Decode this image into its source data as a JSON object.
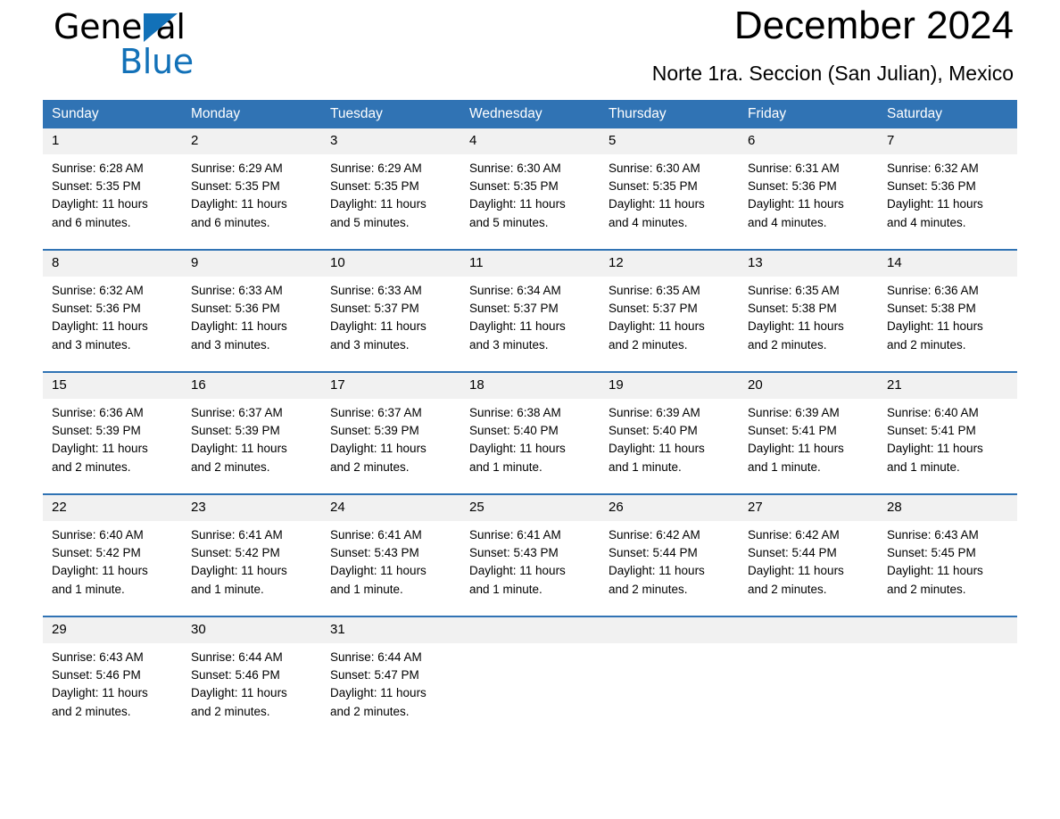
{
  "brand": {
    "name_part1": "General",
    "name_part2": "Blue",
    "triangle_color": "#1271b8"
  },
  "header": {
    "title": "December 2024",
    "subtitle": "Norte 1ra. Seccion (San Julian), Mexico"
  },
  "theme": {
    "header_blue": "#3073b4",
    "daynum_band": "#f1f1f1",
    "text": "#000000",
    "brand_blue": "#1271b8"
  },
  "weekday_headers": [
    "Sunday",
    "Monday",
    "Tuesday",
    "Wednesday",
    "Thursday",
    "Friday",
    "Saturday"
  ],
  "weeks": [
    [
      {
        "day": "1",
        "sunrise": "Sunrise: 6:28 AM",
        "sunset": "Sunset: 5:35 PM",
        "daylight_line1": "Daylight: 11 hours",
        "daylight_line2": "and 6 minutes."
      },
      {
        "day": "2",
        "sunrise": "Sunrise: 6:29 AM",
        "sunset": "Sunset: 5:35 PM",
        "daylight_line1": "Daylight: 11 hours",
        "daylight_line2": "and 6 minutes."
      },
      {
        "day": "3",
        "sunrise": "Sunrise: 6:29 AM",
        "sunset": "Sunset: 5:35 PM",
        "daylight_line1": "Daylight: 11 hours",
        "daylight_line2": "and 5 minutes."
      },
      {
        "day": "4",
        "sunrise": "Sunrise: 6:30 AM",
        "sunset": "Sunset: 5:35 PM",
        "daylight_line1": "Daylight: 11 hours",
        "daylight_line2": "and 5 minutes."
      },
      {
        "day": "5",
        "sunrise": "Sunrise: 6:30 AM",
        "sunset": "Sunset: 5:35 PM",
        "daylight_line1": "Daylight: 11 hours",
        "daylight_line2": "and 4 minutes."
      },
      {
        "day": "6",
        "sunrise": "Sunrise: 6:31 AM",
        "sunset": "Sunset: 5:36 PM",
        "daylight_line1": "Daylight: 11 hours",
        "daylight_line2": "and 4 minutes."
      },
      {
        "day": "7",
        "sunrise": "Sunrise: 6:32 AM",
        "sunset": "Sunset: 5:36 PM",
        "daylight_line1": "Daylight: 11 hours",
        "daylight_line2": "and 4 minutes."
      }
    ],
    [
      {
        "day": "8",
        "sunrise": "Sunrise: 6:32 AM",
        "sunset": "Sunset: 5:36 PM",
        "daylight_line1": "Daylight: 11 hours",
        "daylight_line2": "and 3 minutes."
      },
      {
        "day": "9",
        "sunrise": "Sunrise: 6:33 AM",
        "sunset": "Sunset: 5:36 PM",
        "daylight_line1": "Daylight: 11 hours",
        "daylight_line2": "and 3 minutes."
      },
      {
        "day": "10",
        "sunrise": "Sunrise: 6:33 AM",
        "sunset": "Sunset: 5:37 PM",
        "daylight_line1": "Daylight: 11 hours",
        "daylight_line2": "and 3 minutes."
      },
      {
        "day": "11",
        "sunrise": "Sunrise: 6:34 AM",
        "sunset": "Sunset: 5:37 PM",
        "daylight_line1": "Daylight: 11 hours",
        "daylight_line2": "and 3 minutes."
      },
      {
        "day": "12",
        "sunrise": "Sunrise: 6:35 AM",
        "sunset": "Sunset: 5:37 PM",
        "daylight_line1": "Daylight: 11 hours",
        "daylight_line2": "and 2 minutes."
      },
      {
        "day": "13",
        "sunrise": "Sunrise: 6:35 AM",
        "sunset": "Sunset: 5:38 PM",
        "daylight_line1": "Daylight: 11 hours",
        "daylight_line2": "and 2 minutes."
      },
      {
        "day": "14",
        "sunrise": "Sunrise: 6:36 AM",
        "sunset": "Sunset: 5:38 PM",
        "daylight_line1": "Daylight: 11 hours",
        "daylight_line2": "and 2 minutes."
      }
    ],
    [
      {
        "day": "15",
        "sunrise": "Sunrise: 6:36 AM",
        "sunset": "Sunset: 5:39 PM",
        "daylight_line1": "Daylight: 11 hours",
        "daylight_line2": "and 2 minutes."
      },
      {
        "day": "16",
        "sunrise": "Sunrise: 6:37 AM",
        "sunset": "Sunset: 5:39 PM",
        "daylight_line1": "Daylight: 11 hours",
        "daylight_line2": "and 2 minutes."
      },
      {
        "day": "17",
        "sunrise": "Sunrise: 6:37 AM",
        "sunset": "Sunset: 5:39 PM",
        "daylight_line1": "Daylight: 11 hours",
        "daylight_line2": "and 2 minutes."
      },
      {
        "day": "18",
        "sunrise": "Sunrise: 6:38 AM",
        "sunset": "Sunset: 5:40 PM",
        "daylight_line1": "Daylight: 11 hours",
        "daylight_line2": "and 1 minute."
      },
      {
        "day": "19",
        "sunrise": "Sunrise: 6:39 AM",
        "sunset": "Sunset: 5:40 PM",
        "daylight_line1": "Daylight: 11 hours",
        "daylight_line2": "and 1 minute."
      },
      {
        "day": "20",
        "sunrise": "Sunrise: 6:39 AM",
        "sunset": "Sunset: 5:41 PM",
        "daylight_line1": "Daylight: 11 hours",
        "daylight_line2": "and 1 minute."
      },
      {
        "day": "21",
        "sunrise": "Sunrise: 6:40 AM",
        "sunset": "Sunset: 5:41 PM",
        "daylight_line1": "Daylight: 11 hours",
        "daylight_line2": "and 1 minute."
      }
    ],
    [
      {
        "day": "22",
        "sunrise": "Sunrise: 6:40 AM",
        "sunset": "Sunset: 5:42 PM",
        "daylight_line1": "Daylight: 11 hours",
        "daylight_line2": "and 1 minute."
      },
      {
        "day": "23",
        "sunrise": "Sunrise: 6:41 AM",
        "sunset": "Sunset: 5:42 PM",
        "daylight_line1": "Daylight: 11 hours",
        "daylight_line2": "and 1 minute."
      },
      {
        "day": "24",
        "sunrise": "Sunrise: 6:41 AM",
        "sunset": "Sunset: 5:43 PM",
        "daylight_line1": "Daylight: 11 hours",
        "daylight_line2": "and 1 minute."
      },
      {
        "day": "25",
        "sunrise": "Sunrise: 6:41 AM",
        "sunset": "Sunset: 5:43 PM",
        "daylight_line1": "Daylight: 11 hours",
        "daylight_line2": "and 1 minute."
      },
      {
        "day": "26",
        "sunrise": "Sunrise: 6:42 AM",
        "sunset": "Sunset: 5:44 PM",
        "daylight_line1": "Daylight: 11 hours",
        "daylight_line2": "and 2 minutes."
      },
      {
        "day": "27",
        "sunrise": "Sunrise: 6:42 AM",
        "sunset": "Sunset: 5:44 PM",
        "daylight_line1": "Daylight: 11 hours",
        "daylight_line2": "and 2 minutes."
      },
      {
        "day": "28",
        "sunrise": "Sunrise: 6:43 AM",
        "sunset": "Sunset: 5:45 PM",
        "daylight_line1": "Daylight: 11 hours",
        "daylight_line2": "and 2 minutes."
      }
    ],
    [
      {
        "day": "29",
        "sunrise": "Sunrise: 6:43 AM",
        "sunset": "Sunset: 5:46 PM",
        "daylight_line1": "Daylight: 11 hours",
        "daylight_line2": "and 2 minutes."
      },
      {
        "day": "30",
        "sunrise": "Sunrise: 6:44 AM",
        "sunset": "Sunset: 5:46 PM",
        "daylight_line1": "Daylight: 11 hours",
        "daylight_line2": "and 2 minutes."
      },
      {
        "day": "31",
        "sunrise": "Sunrise: 6:44 AM",
        "sunset": "Sunset: 5:47 PM",
        "daylight_line1": "Daylight: 11 hours",
        "daylight_line2": "and 2 minutes."
      },
      {
        "day": "",
        "sunrise": "",
        "sunset": "",
        "daylight_line1": "",
        "daylight_line2": ""
      },
      {
        "day": "",
        "sunrise": "",
        "sunset": "",
        "daylight_line1": "",
        "daylight_line2": ""
      },
      {
        "day": "",
        "sunrise": "",
        "sunset": "",
        "daylight_line1": "",
        "daylight_line2": ""
      },
      {
        "day": "",
        "sunrise": "",
        "sunset": "",
        "daylight_line1": "",
        "daylight_line2": ""
      }
    ]
  ]
}
